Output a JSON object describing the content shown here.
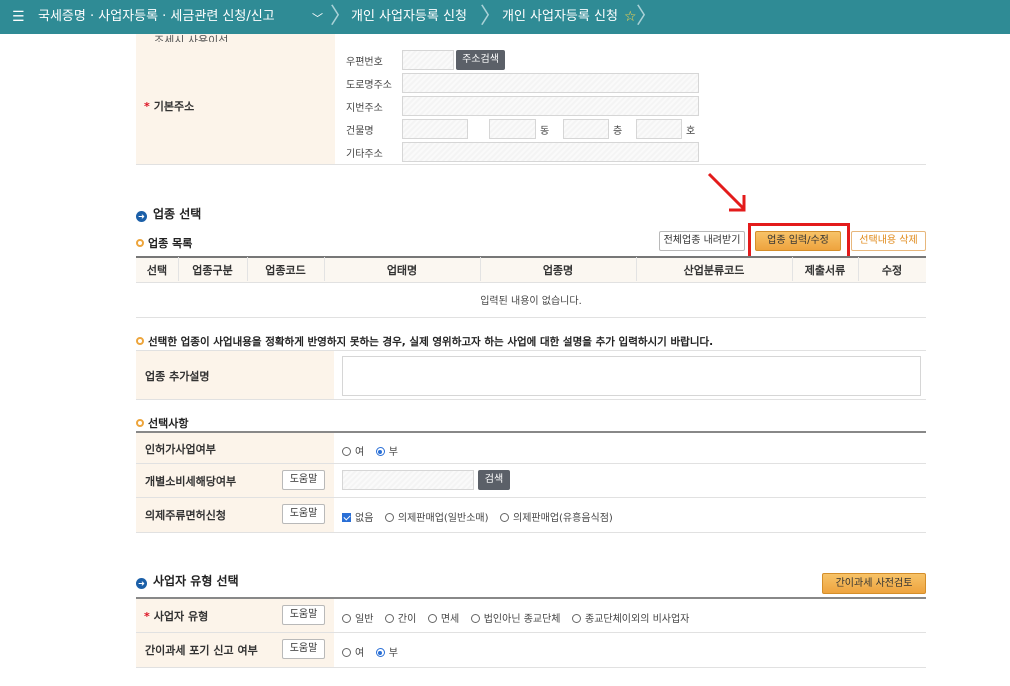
{
  "topbar": {
    "menu_icon": "menu-icon",
    "crumb1": "국세증명 · 사업자등록 · 세금관련 신청/신고",
    "crumb2": "개인 사업자등록 신청",
    "crumb3": "개인 사업자등록 신청",
    "favorite_icon": "star-icon"
  },
  "address": {
    "partial_label": "조세시 사용이선",
    "label": "기본주소",
    "postal_label": "우편번호",
    "search_button": "주소검색",
    "road_label": "도로명주소",
    "lot_label": "지번주소",
    "building_label": "건물명",
    "dong": "동",
    "floor": "층",
    "ho": "호",
    "other_label": "기타주소"
  },
  "business": {
    "section_title": "업종 선택",
    "list_title": "업종 목록",
    "download_button": "전체업종 내려받기",
    "edit_button": "업종 입력/수정",
    "delete_button": "선택내용 삭제",
    "columns": [
      "선택",
      "업종구분",
      "업종코드",
      "업태명",
      "업종명",
      "산업분류코드",
      "제출서류",
      "수정"
    ],
    "empty_text": "입력된 내용이 없습니다.",
    "notice": "선택한 업종이 사업내용을 정확하게 반영하지 못하는 경우, 실제 영위하고자 하는 사업에 대한 설명을 추가 입력하시기 바랍니다.",
    "extra_label": "업종 추가설명"
  },
  "options": {
    "title": "선택사항",
    "permit_label": "인허가사업여부",
    "permit_yes": "여",
    "permit_no": "부",
    "excise_label": "개별소비세해당여부",
    "help": "도움말",
    "search_button": "검색",
    "liquor_label": "의제주류면허신청",
    "liquor_none": "없음",
    "liquor_retail": "의제판매업(일반소매)",
    "liquor_bar": "의제판매업(유흥음식점)"
  },
  "biztype": {
    "section_title": "사업자 유형 선택",
    "precheck_button": "간이과세 사전검토",
    "type_label": "사업자 유형",
    "types": [
      "일반",
      "간이",
      "면세",
      "법인아닌 종교단체",
      "종교단체이외의 비사업자"
    ],
    "giveup_label": "간이과세 포기 신고 여부",
    "yes": "여",
    "no": "부"
  },
  "colors": {
    "topbar": "#2f8b95",
    "label_bg": "#fcf4ea",
    "highlight": "#e31b1b",
    "orange_button": "#eea33e"
  }
}
